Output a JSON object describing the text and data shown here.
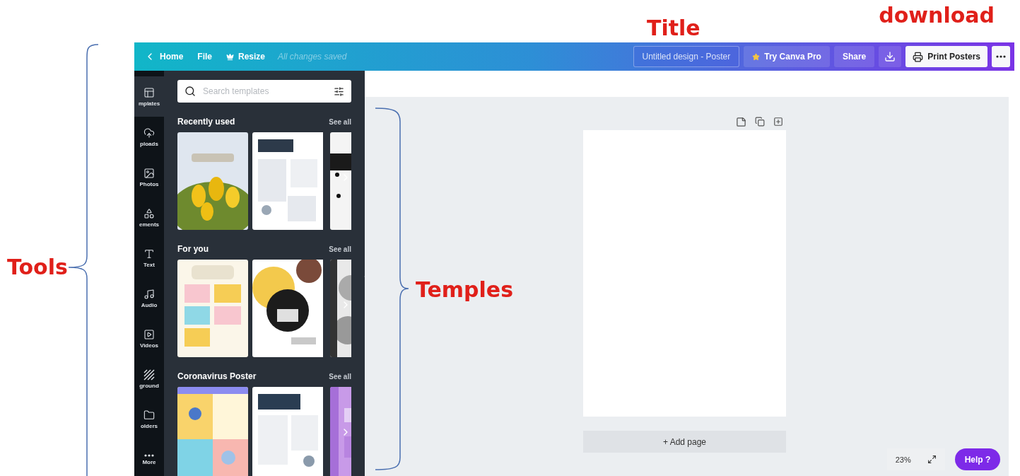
{
  "annotations": {
    "title": "Title",
    "download": "download",
    "tools": "Tools",
    "templates": "Temples"
  },
  "top_bar": {
    "back": "Home",
    "file": "File",
    "resize": "Resize",
    "save_status": "All changes saved",
    "design_title": "Untitled design - Poster",
    "pro": "Try Canva Pro",
    "share": "Share",
    "print": "Print Posters"
  },
  "sidebar": {
    "items": [
      {
        "label": "mplates",
        "selected": true
      },
      {
        "label": "ploads",
        "selected": false
      },
      {
        "label": "Photos",
        "selected": false
      },
      {
        "label": "ements",
        "selected": false
      },
      {
        "label": "Text",
        "selected": false
      },
      {
        "label": "Audio",
        "selected": false
      },
      {
        "label": "Videos",
        "selected": false
      },
      {
        "label": "ground",
        "selected": false
      },
      {
        "label": "olders",
        "selected": false
      },
      {
        "label": "More",
        "selected": false
      }
    ]
  },
  "templates_panel": {
    "search": {
      "placeholder": "Search templates"
    },
    "sections": [
      {
        "title": "Recently used",
        "see_all": "See all"
      },
      {
        "title": "For you",
        "see_all": "See all"
      },
      {
        "title": "Coronavirus Poster",
        "see_all": "See all"
      }
    ]
  },
  "canvas": {
    "add_page": "+ Add page",
    "zoom": "23%",
    "help": "Help ?"
  }
}
